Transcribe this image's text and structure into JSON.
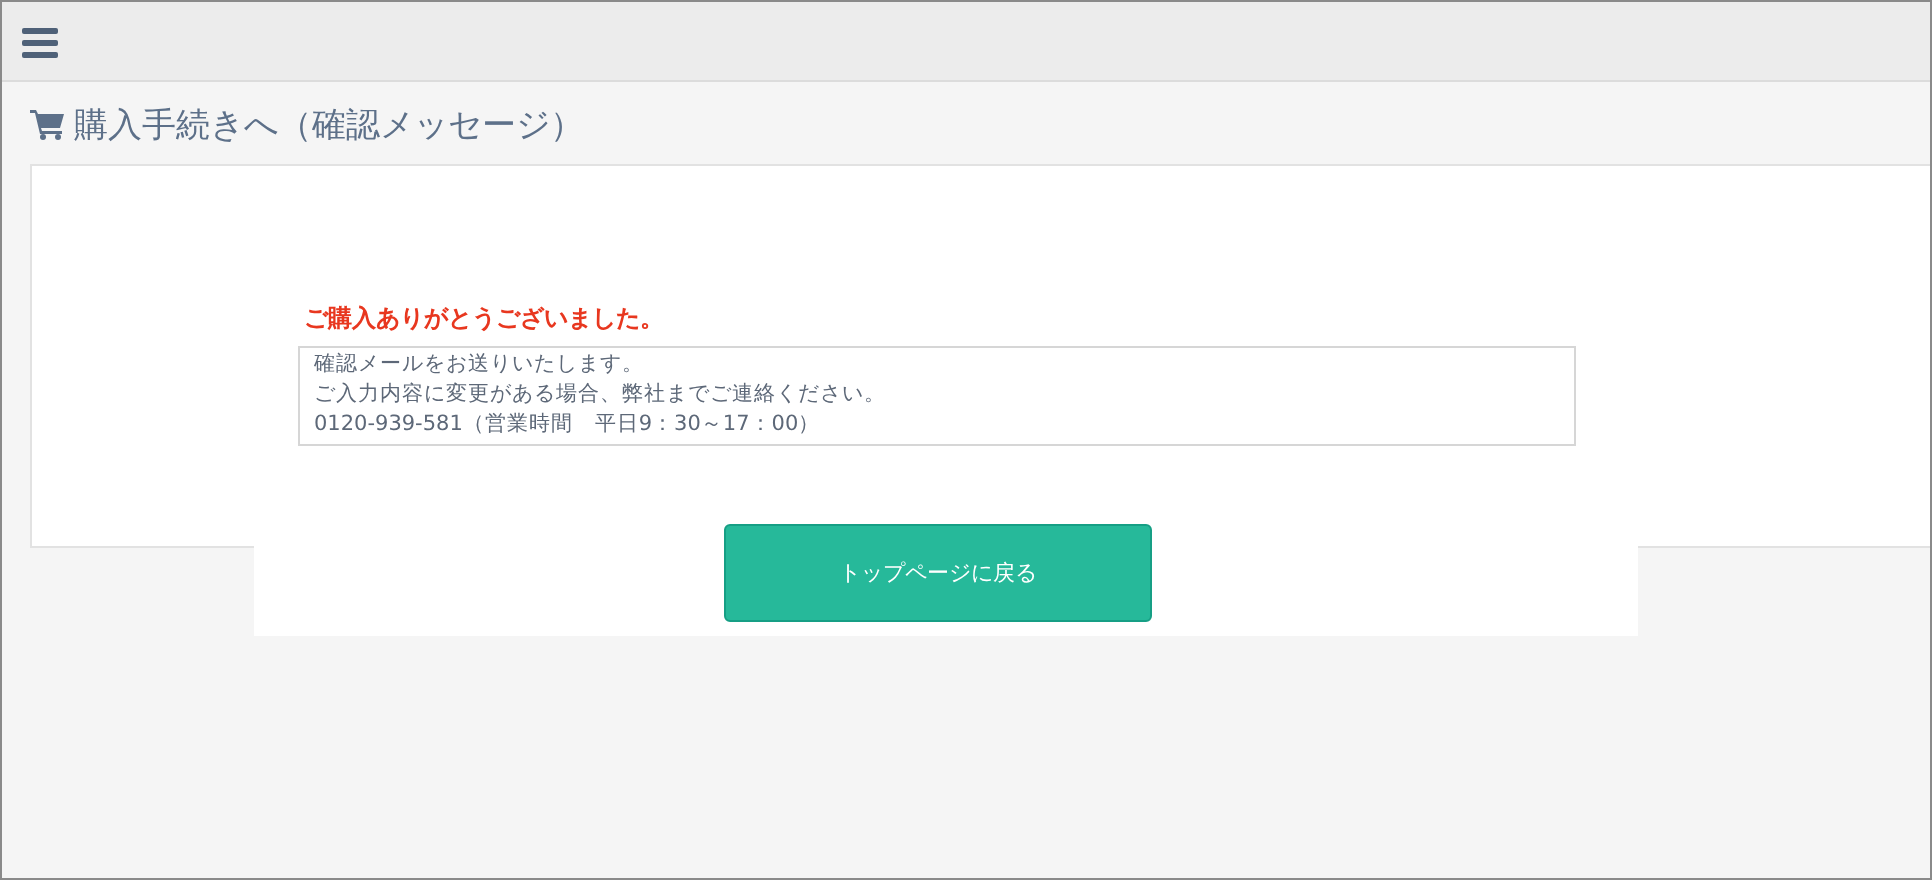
{
  "heading": "購入手続きへ（確認メッセージ）",
  "thanks": "ご購入ありがとうございました。",
  "message_lines": [
    "確認メールをお送りいたします。",
    "ご入力内容に変更がある場合、弊社までご連絡ください。",
    "0120-939-581（営業時間　平日9：30～17：00）"
  ],
  "button": "トップページに戻る"
}
